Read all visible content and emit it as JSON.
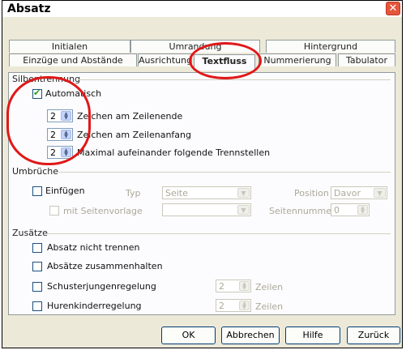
{
  "window": {
    "title": "Absatz",
    "close_glyph": "✕"
  },
  "tabs": {
    "row1": [
      "Initialen",
      "Umrandung",
      "Hintergrund"
    ],
    "row2": [
      "Einzüge und Abstände",
      "Ausrichtung",
      "Textfluss",
      "Nummerierung",
      "Tabulator"
    ],
    "active": "Textfluss"
  },
  "silbentrennung": {
    "header": "Silbentrennung",
    "automatisch": {
      "label": "Automatisch",
      "checked": true
    },
    "fields": [
      {
        "value": "2",
        "label": "Zeichen am Zeilenende"
      },
      {
        "value": "2",
        "label": "Zeichen am Zeilenanfang"
      },
      {
        "value": "2",
        "label": "Maximal aufeinander folgende Trennstellen"
      }
    ]
  },
  "umbrueche": {
    "header": "Umbrüche",
    "einfuegen": "Einfügen",
    "typ_label": "Typ",
    "typ_value": "Seite",
    "position_label": "Position",
    "position_value": "Davor",
    "mit_seitenvorlage": "mit Seitenvorlage",
    "seitennummer_label": "Seitennummer",
    "seitennummer_value": "0"
  },
  "zusaetze": {
    "header": "Zusätze",
    "items": [
      "Absatz nicht trennen",
      "Absätze zusammenhalten",
      "Schusterjungenregelung",
      "Hurenkinderregelung"
    ],
    "schuster_value": "2",
    "huren_value": "2",
    "zeilen": "Zeilen"
  },
  "buttons": {
    "ok": "OK",
    "abbrechen": "Abbrechen",
    "hilfe": "Hilfe",
    "zurueck": "Zurück"
  },
  "colors": {
    "annotation_ring": "#e01818",
    "close_button": "#e4553c"
  }
}
